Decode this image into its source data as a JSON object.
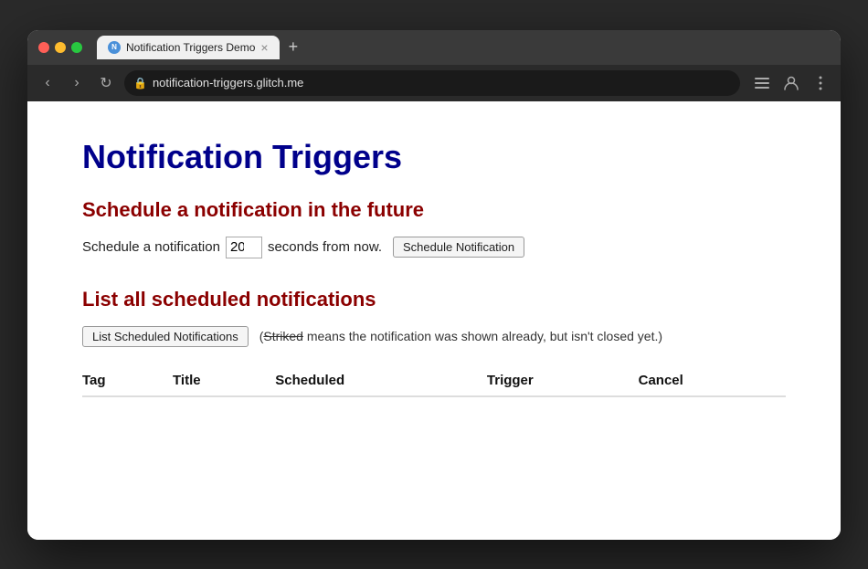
{
  "browser": {
    "tab": {
      "favicon_label": "N",
      "title": "Notification Triggers Demo",
      "close_icon": "×",
      "new_tab_icon": "+"
    },
    "nav": {
      "back": "‹",
      "forward": "›",
      "reload": "↻"
    },
    "address": {
      "lock_icon": "🔒",
      "url": "notification-triggers.glitch.me"
    },
    "toolbar": {
      "list_icon": "≡",
      "user_icon": "👤",
      "menu_icon": "⋮"
    }
  },
  "page": {
    "title": "Notification Triggers",
    "section1": {
      "heading": "Schedule a notification in the future",
      "label_before": "Schedule a notification",
      "input_value": "20",
      "label_after": "seconds from now.",
      "button_label": "Schedule Notification"
    },
    "section2": {
      "heading": "List all scheduled notifications",
      "list_button_label": "List Scheduled Notifications",
      "note_prefix": "(",
      "note_striked": "Striked",
      "note_suffix": " means the notification was shown already, but isn't closed yet.)",
      "table": {
        "columns": [
          "Tag",
          "Title",
          "Scheduled",
          "Trigger",
          "Cancel"
        ],
        "rows": []
      }
    }
  }
}
